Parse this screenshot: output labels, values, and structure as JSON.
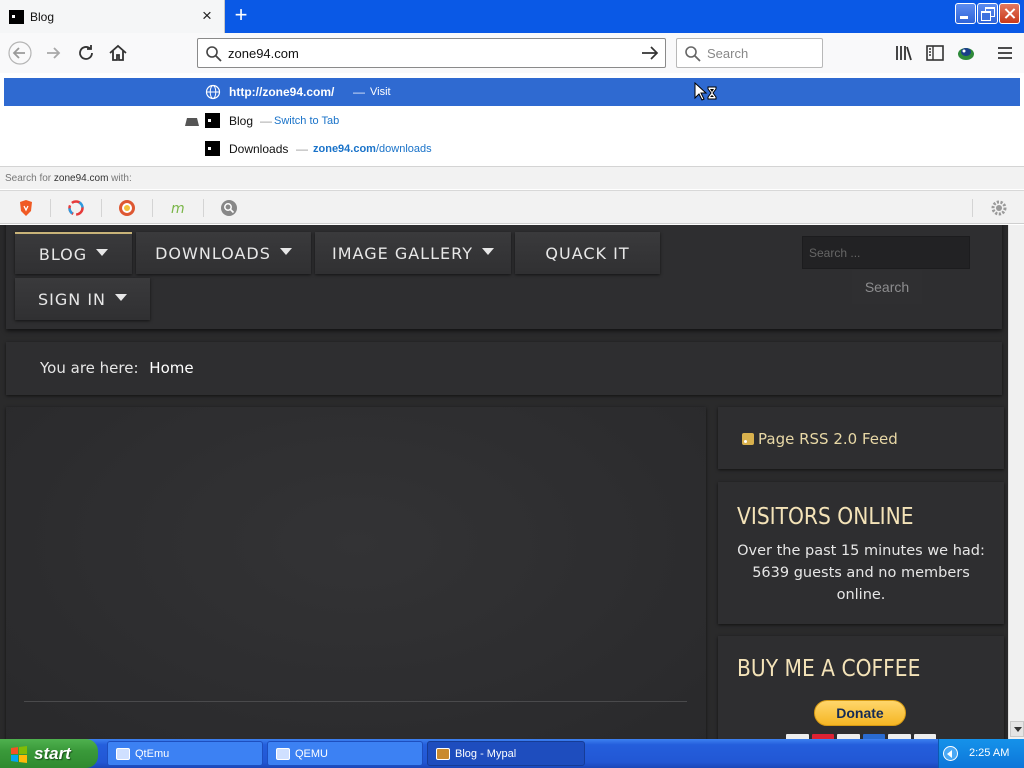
{
  "browser": {
    "tab": {
      "title": "Blog"
    },
    "url_bar": {
      "value": "zone94.com"
    },
    "search_bar": {
      "placeholder": "Search"
    }
  },
  "dropdown": {
    "selected": {
      "url": "http://zone94.com/",
      "separator": "—",
      "action": "Visit"
    },
    "rows": [
      {
        "title": "Blog",
        "separator": "—",
        "action": "Switch to Tab"
      },
      {
        "title": "Downloads",
        "separator": "—",
        "url_bold": "zone94.com",
        "url_rest": "/downloads"
      }
    ],
    "search_for_prefix": "Search for ",
    "search_for_term": "zone94.com",
    "search_for_suffix": " with:",
    "engines": [
      "brave-icon",
      "qwant-icon",
      "duckduckgo-icon",
      "mojeek-icon",
      "search-engine-icon"
    ]
  },
  "site": {
    "menu": [
      {
        "label": "BLOG",
        "has_caret": true,
        "active": true
      },
      {
        "label": "DOWNLOADS",
        "has_caret": true
      },
      {
        "label": "IMAGE GALLERY",
        "has_caret": true
      },
      {
        "label": "QUACK IT",
        "has_caret": false
      },
      {
        "label": "SIGN IN",
        "has_caret": true
      }
    ],
    "search": {
      "placeholder": "Search ...",
      "button": "Search"
    },
    "breadcrumb": {
      "prefix": "You are here:",
      "current": "Home"
    },
    "rss": {
      "label": "Page RSS 2.0 Feed"
    },
    "visitors": {
      "title": "VISITORS ONLINE",
      "text": "Over the past 15 minutes we had: 5639 guests and no members online."
    },
    "coffee": {
      "title": "BUY ME A COFFEE",
      "button": "Donate"
    }
  },
  "taskbar": {
    "start": "start",
    "tasks": [
      "QtEmu",
      "QEMU",
      "Blog - Mypal"
    ],
    "clock": "2:25 AM"
  },
  "colors": {
    "titlebar": "#0a59e6",
    "dropdown_selected": "#2f6ad1",
    "page_bg": "#2a2a2b",
    "module_title": "#f4e3b8",
    "accent_gold": "#c9b479"
  }
}
